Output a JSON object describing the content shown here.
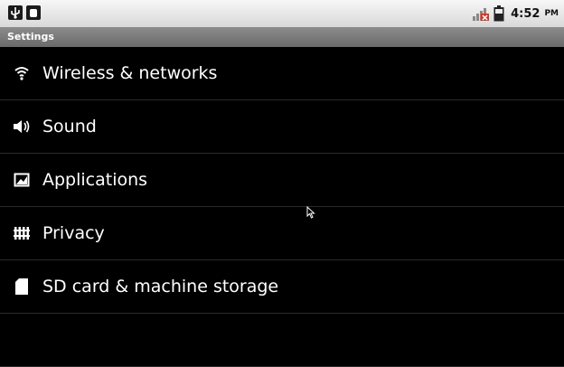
{
  "status_bar": {
    "left_icons": [
      "usb-icon",
      "usb-debugging-icon"
    ],
    "right_icons": [
      "no-signal-icon",
      "battery-icon"
    ],
    "time": "4:52",
    "ampm": "PM"
  },
  "title": "Settings",
  "items": [
    {
      "icon": "wifi-icon",
      "label": "Wireless & networks"
    },
    {
      "icon": "speaker-icon",
      "label": "Sound"
    },
    {
      "icon": "applications-icon",
      "label": "Applications"
    },
    {
      "icon": "privacy-icon",
      "label": "Privacy"
    },
    {
      "icon": "sd-card-icon",
      "label": "SD card & machine storage"
    },
    {
      "icon": "",
      "label": ""
    }
  ],
  "colors": {
    "background": "#000000",
    "text": "#ffffff",
    "title_bar": "#7a7a7a",
    "status_bar": "#e6e6e6"
  }
}
